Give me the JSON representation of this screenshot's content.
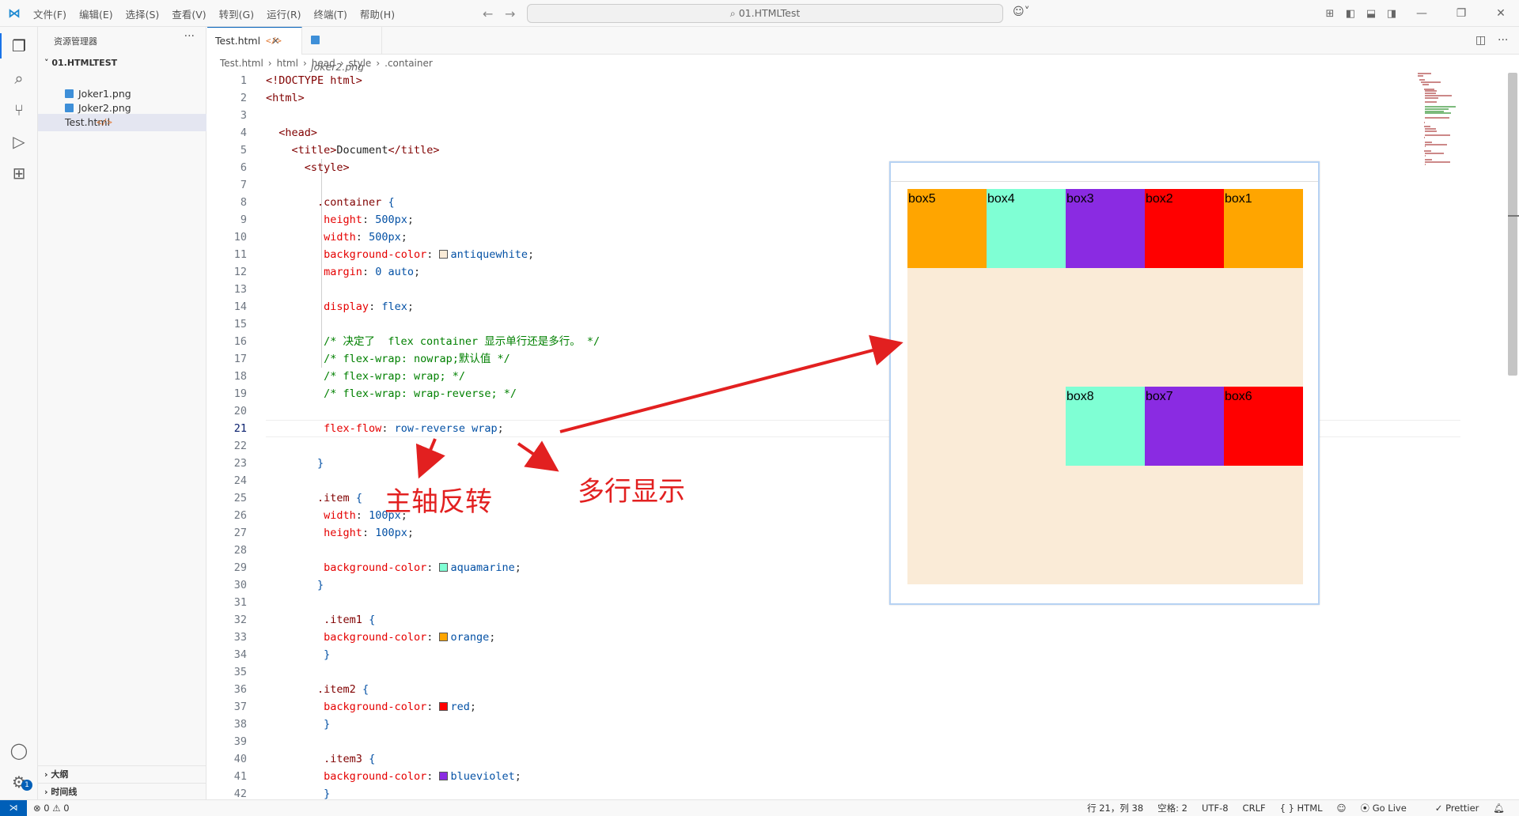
{
  "menu": [
    "文件(F)",
    "编辑(E)",
    "选择(S)",
    "查看(V)",
    "转到(G)",
    "运行(R)",
    "终端(T)",
    "帮助(H)"
  ],
  "search": {
    "label": "01.HTMLTest"
  },
  "sidebar": {
    "title": "资源管理器",
    "folder": "01.HTMLTEST",
    "files": [
      {
        "name": "Joker1.png",
        "type": "image"
      },
      {
        "name": "Joker2.png",
        "type": "image"
      },
      {
        "name": "Test.html",
        "type": "html",
        "selected": true
      }
    ],
    "outline": "大纲",
    "timeline": "时间线"
  },
  "tabs": [
    {
      "label": "Test.html",
      "icon": "</>",
      "active": true
    },
    {
      "label": "Joker2.png",
      "preview": true
    }
  ],
  "breadcrumb": [
    "Test.html",
    "html",
    "head",
    "style",
    ".container"
  ],
  "code": {
    "current_line": 21,
    "lines": [
      [
        [
          "tag",
          "<!DOCTYPE html>"
        ]
      ],
      [
        [
          "tag",
          "<html>"
        ]
      ],
      [],
      [
        [
          "ind",
          "  "
        ],
        [
          "tag",
          "<head>"
        ]
      ],
      [
        [
          "ind",
          "    "
        ],
        [
          "tag",
          "<title>"
        ],
        [
          "txt",
          "Document"
        ],
        [
          "tag",
          "</title>"
        ]
      ],
      [
        [
          "ind",
          "      "
        ],
        [
          "tag",
          "<style>"
        ]
      ],
      [],
      [
        [
          "ind",
          "        "
        ],
        [
          "sel-c",
          ".container"
        ],
        [
          "pun",
          " "
        ],
        [
          "val",
          "{"
        ]
      ],
      [
        [
          "ind",
          "         "
        ],
        [
          "prop",
          "height"
        ],
        [
          "pun",
          ": "
        ],
        [
          "val",
          "500px"
        ],
        [
          "pun",
          ";"
        ]
      ],
      [
        [
          "ind",
          "         "
        ],
        [
          "prop",
          "width"
        ],
        [
          "pun",
          ": "
        ],
        [
          "val",
          "500px"
        ],
        [
          "pun",
          ";"
        ]
      ],
      [
        [
          "ind",
          "         "
        ],
        [
          "prop",
          "background-color"
        ],
        [
          "pun",
          ": "
        ],
        [
          "swatch",
          "#faebd7"
        ],
        [
          "val",
          "antiquewhite"
        ],
        [
          "pun",
          ";"
        ]
      ],
      [
        [
          "ind",
          "         "
        ],
        [
          "prop",
          "margin"
        ],
        [
          "pun",
          ": "
        ],
        [
          "val",
          "0 auto"
        ],
        [
          "pun",
          ";"
        ]
      ],
      [],
      [
        [
          "ind",
          "         "
        ],
        [
          "prop",
          "display"
        ],
        [
          "pun",
          ": "
        ],
        [
          "val",
          "flex"
        ],
        [
          "pun",
          ";"
        ]
      ],
      [],
      [
        [
          "ind",
          "         "
        ],
        [
          "cm",
          "/* 决定了  flex container 显示单行还是多行。 */"
        ]
      ],
      [
        [
          "ind",
          "         "
        ],
        [
          "cm",
          "/* flex-wrap: nowrap;默认值 */"
        ]
      ],
      [
        [
          "ind",
          "         "
        ],
        [
          "cm",
          "/* flex-wrap: wrap; */"
        ]
      ],
      [
        [
          "ind",
          "         "
        ],
        [
          "cm",
          "/* flex-wrap: wrap-reverse; */"
        ]
      ],
      [],
      [
        [
          "ind",
          "         "
        ],
        [
          "prop",
          "flex-flow"
        ],
        [
          "pun",
          ": "
        ],
        [
          "val",
          "row-reverse wrap"
        ],
        [
          "pun",
          ";"
        ]
      ],
      [],
      [
        [
          "ind",
          "        "
        ],
        [
          "val",
          "}"
        ]
      ],
      [],
      [
        [
          "ind",
          "        "
        ],
        [
          "sel-c",
          ".item"
        ],
        [
          "pun",
          " "
        ],
        [
          "val",
          "{"
        ]
      ],
      [
        [
          "ind",
          "         "
        ],
        [
          "prop",
          "width"
        ],
        [
          "pun",
          ": "
        ],
        [
          "val",
          "100px"
        ],
        [
          "pun",
          ";"
        ]
      ],
      [
        [
          "ind",
          "         "
        ],
        [
          "prop",
          "height"
        ],
        [
          "pun",
          ": "
        ],
        [
          "val",
          "100px"
        ],
        [
          "pun",
          ";"
        ]
      ],
      [],
      [
        [
          "ind",
          "         "
        ],
        [
          "prop",
          "background-color"
        ],
        [
          "pun",
          ": "
        ],
        [
          "swatch",
          "#7fffd4"
        ],
        [
          "val",
          "aquamarine"
        ],
        [
          "pun",
          ";"
        ]
      ],
      [
        [
          "ind",
          "        "
        ],
        [
          "val",
          "}"
        ]
      ],
      [],
      [
        [
          "ind",
          "         "
        ],
        [
          "sel-c",
          ".item1"
        ],
        [
          "pun",
          " "
        ],
        [
          "val",
          "{"
        ]
      ],
      [
        [
          "ind",
          "         "
        ],
        [
          "prop",
          "background-color"
        ],
        [
          "pun",
          ": "
        ],
        [
          "swatch",
          "#ffa500"
        ],
        [
          "val",
          "orange"
        ],
        [
          "pun",
          ";"
        ]
      ],
      [
        [
          "ind",
          "         "
        ],
        [
          "val",
          "}"
        ]
      ],
      [],
      [
        [
          "ind",
          "        "
        ],
        [
          "sel-c",
          ".item2"
        ],
        [
          "pun",
          " "
        ],
        [
          "val",
          "{"
        ]
      ],
      [
        [
          "ind",
          "         "
        ],
        [
          "prop",
          "background-color"
        ],
        [
          "pun",
          ": "
        ],
        [
          "swatch",
          "#ff0000"
        ],
        [
          "val",
          "red"
        ],
        [
          "pun",
          ";"
        ]
      ],
      [
        [
          "ind",
          "         "
        ],
        [
          "val",
          "}"
        ]
      ],
      [],
      [
        [
          "ind",
          "         "
        ],
        [
          "sel-c",
          ".item3"
        ],
        [
          "pun",
          " "
        ],
        [
          "val",
          "{"
        ]
      ],
      [
        [
          "ind",
          "         "
        ],
        [
          "prop",
          "background-color"
        ],
        [
          "pun",
          ": "
        ],
        [
          "swatch",
          "#8a2be2"
        ],
        [
          "val",
          "blueviolet"
        ],
        [
          "pun",
          ";"
        ]
      ],
      [
        [
          "ind",
          "         "
        ],
        [
          "val",
          "}"
        ]
      ]
    ]
  },
  "preview": {
    "container_color": "#faebd7",
    "row1": [
      {
        "label": "box5",
        "color": "#ffa500"
      },
      {
        "label": "box4",
        "color": "#7fffd4"
      },
      {
        "label": "box3",
        "color": "#8a2be2"
      },
      {
        "label": "box2",
        "color": "#ff0000"
      },
      {
        "label": "box1",
        "color": "#ffa500"
      }
    ],
    "row2": [
      {
        "label": "box8",
        "color": "#7fffd4"
      },
      {
        "label": "box7",
        "color": "#8a2be2"
      },
      {
        "label": "box6",
        "color": "#ff0000"
      }
    ]
  },
  "annotations": {
    "main_axis": "主轴反转",
    "multiline": "多行显示",
    "color": "#e22020"
  },
  "status": {
    "problems": "⊗ 0 ⚠ 0",
    "position": "行 21，列 38",
    "spaces": "空格: 2",
    "encoding": "UTF-8",
    "eol": "CRLF",
    "language": "{ } HTML",
    "golive": "Go Live",
    "prettier": "✓ Prettier"
  }
}
